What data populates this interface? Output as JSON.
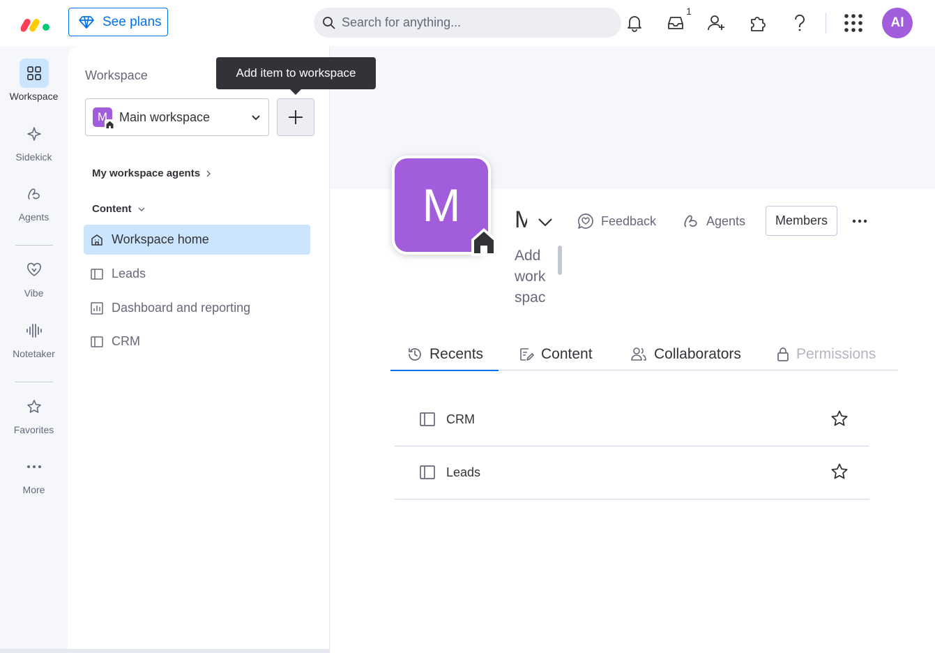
{
  "topbar": {
    "see_plans": "See plans",
    "search_placeholder": "Search for anything...",
    "inbox_badge": "1",
    "avatar_initials": "AI"
  },
  "rail": {
    "items": [
      {
        "label": "Workspace",
        "icon": "grid-icon"
      },
      {
        "label": "Sidekick",
        "icon": "sparkle-icon"
      },
      {
        "label": "Agents",
        "icon": "agents-icon"
      },
      {
        "label": "Vibe",
        "icon": "heart-icon"
      },
      {
        "label": "Notetaker",
        "icon": "waveform-icon"
      },
      {
        "label": "Favorites",
        "icon": "star-icon"
      },
      {
        "label": "More",
        "icon": "more-horizontal-icon"
      }
    ]
  },
  "panel": {
    "title": "Workspace",
    "workspace_letter": "M",
    "workspace_name": "Main workspace",
    "agents_link": "My workspace agents",
    "content_label": "Content",
    "items": [
      {
        "label": "Workspace home",
        "icon": "home-icon"
      },
      {
        "label": "Leads",
        "icon": "board-icon"
      },
      {
        "label": "Dashboard and reporting",
        "icon": "dashboard-icon"
      },
      {
        "label": "CRM",
        "icon": "board-icon"
      }
    ]
  },
  "tooltip": "Add item to workspace",
  "main": {
    "avatar_letter": "M",
    "workspace_name": "Main workspace",
    "description_lines": [
      "Add",
      "work",
      "spac"
    ],
    "feedback": "Feedback",
    "agents": "Agents",
    "members": "Members",
    "tabs": [
      {
        "label": "Recents",
        "icon": "history-icon"
      },
      {
        "label": "Content",
        "icon": "content-icon"
      },
      {
        "label": "Collaborators",
        "icon": "people-icon"
      },
      {
        "label": "Permissions",
        "icon": "lock-icon"
      }
    ],
    "recents": [
      {
        "label": "CRM"
      },
      {
        "label": "Leads"
      }
    ]
  },
  "colors": {
    "accent": "#0073ea",
    "workspace_purple": "#a25ddc",
    "selected_bg": "#cce5ff"
  }
}
